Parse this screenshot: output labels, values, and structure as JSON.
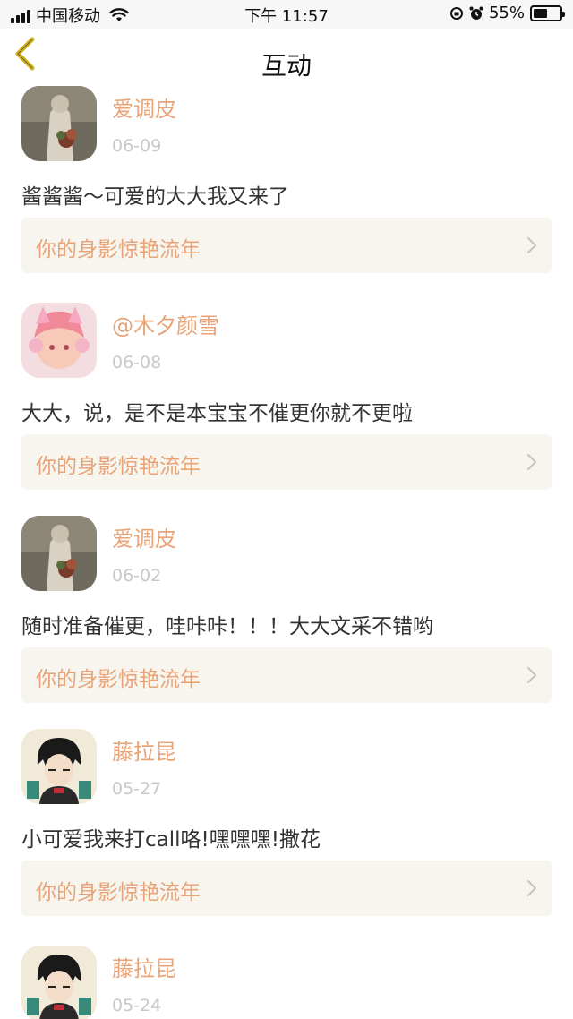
{
  "status_bar": {
    "carrier": "中国移动",
    "time": "下午 11:57",
    "battery_text": "55%",
    "battery_level": 0.55
  },
  "nav": {
    "title": "互动",
    "back_icon": "chevron-left-icon",
    "accent": "#d4b21c"
  },
  "colors": {
    "username": "#e8a478",
    "date": "#c8c8c8",
    "card_bg": "#f7f5ee"
  },
  "items": [
    {
      "username": "爱调皮",
      "date": "06-09",
      "content": "酱酱酱～可爱的大大我又来了",
      "ref": "你的身影惊艳流年"
    },
    {
      "username": "@木夕颜雪",
      "date": "06-08",
      "content": "大大，说，是不是本宝宝不催更你就不更啦",
      "ref": "你的身影惊艳流年"
    },
    {
      "username": "爱调皮",
      "date": "06-02",
      "content": "随时准备催更，哇咔咔！！！大大文采不错哟",
      "ref": "你的身影惊艳流年"
    },
    {
      "username": "藤拉昆",
      "date": "05-27",
      "content": "小可爱我来打call咯!嘿嘿嘿!撒花",
      "ref": "你的身影惊艳流年"
    },
    {
      "username": "藤拉昆",
      "date": "05-24",
      "content": "",
      "ref": ""
    }
  ]
}
